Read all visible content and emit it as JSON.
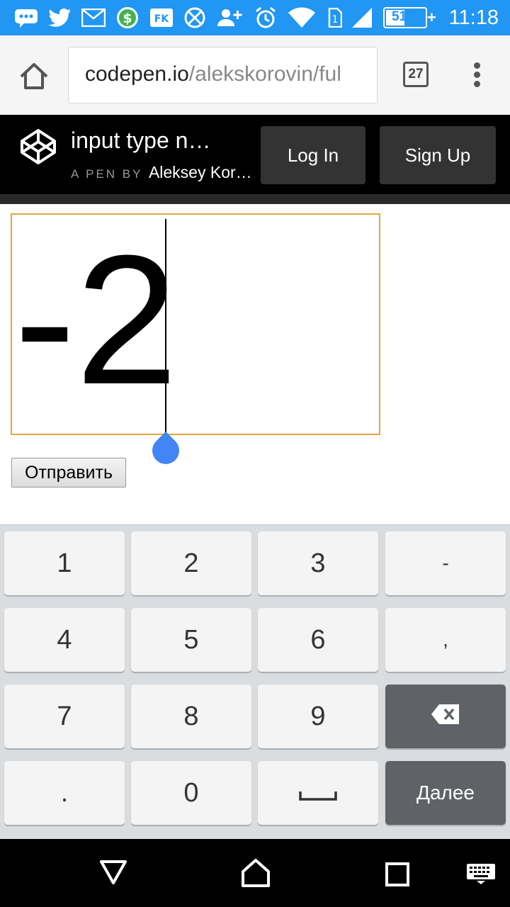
{
  "status_bar": {
    "time": "11:18",
    "battery_percent": "51%",
    "battery_level": 0.51,
    "icons": [
      "messages-icon",
      "twitter-icon",
      "gmail-icon",
      "cash-icon",
      "fk-app-icon",
      "globe-grid-icon",
      "add-contact-icon",
      "alarm-icon",
      "wifi-icon",
      "sim-1-icon",
      "signal-icon",
      "battery-icon",
      "charging-plus-icon"
    ]
  },
  "browser": {
    "url_host": "codepen.io",
    "url_path": "/alekskorovin/ful",
    "tab_count": "27"
  },
  "codepen": {
    "title": "input type n…",
    "sub_label": "A PEN BY",
    "author": "Aleksey Kor…",
    "login_label": "Log In",
    "signup_label": "Sign Up"
  },
  "page": {
    "input_value": "-2",
    "submit_label": "Отправить"
  },
  "keyboard": {
    "row1": [
      "1",
      "2",
      "3",
      "-"
    ],
    "row2": [
      "4",
      "5",
      "6",
      ","
    ],
    "row3": [
      "7",
      "8",
      "9"
    ],
    "row4": [
      ".",
      "0"
    ],
    "next_label": "Далее"
  },
  "colors": {
    "status_bar": "#2196f3",
    "input_border": "#e0a93a",
    "caret_handle": "#4285f4"
  }
}
